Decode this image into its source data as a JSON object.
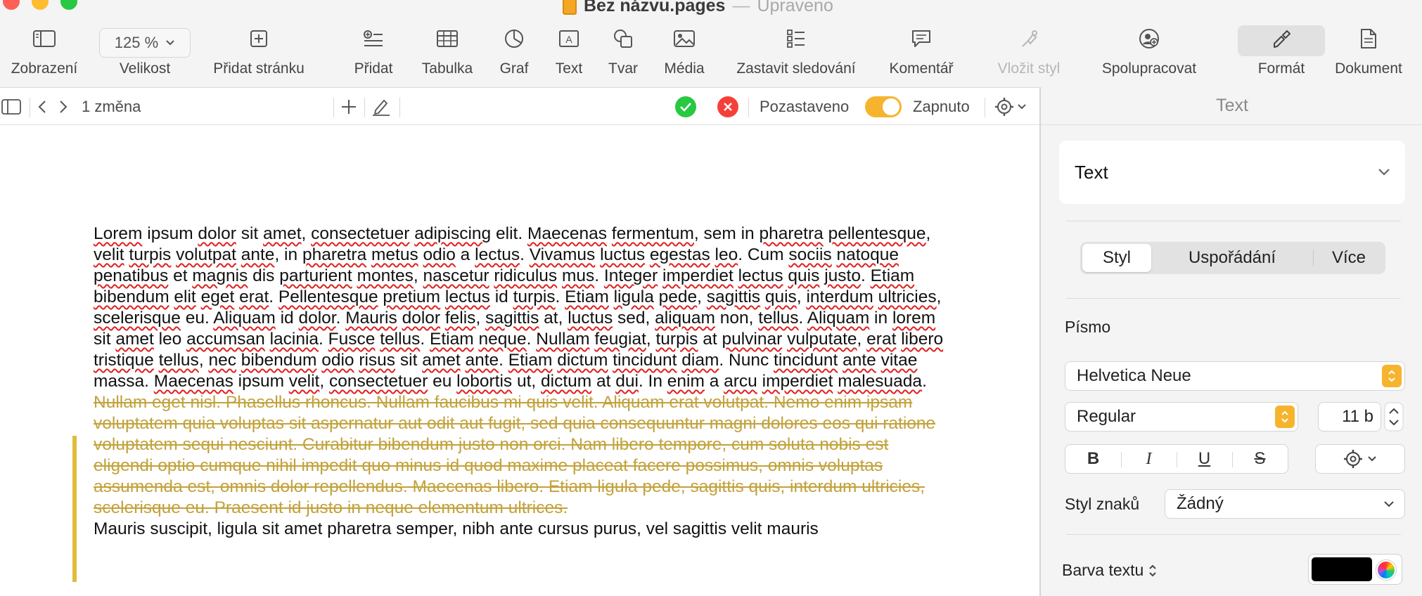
{
  "window": {
    "doc_name": "Bez názvu.pages",
    "separator": "—",
    "status": "Upraveno"
  },
  "toolbar": {
    "zoom_value": "125 %",
    "items": [
      {
        "label": "Zobrazení",
        "icon": "sidebar-icon"
      },
      {
        "label": "Velikost",
        "icon": "zoom-popup"
      },
      {
        "label": "Přidat stránku",
        "icon": "add-page-icon"
      },
      {
        "label": "Přidat",
        "icon": "insert-icon"
      },
      {
        "label": "Tabulka",
        "icon": "table-icon"
      },
      {
        "label": "Graf",
        "icon": "chart-icon"
      },
      {
        "label": "Text",
        "icon": "text-box-icon"
      },
      {
        "label": "Tvar",
        "icon": "shape-icon"
      },
      {
        "label": "Média",
        "icon": "media-icon"
      },
      {
        "label": "Zastavit sledování",
        "icon": "track-changes-icon"
      },
      {
        "label": "Komentář",
        "icon": "comment-icon"
      },
      {
        "label": "Vložit styl",
        "icon": "paste-style-icon"
      },
      {
        "label": "Spolupracovat",
        "icon": "collaborate-icon"
      },
      {
        "label": "Formát",
        "icon": "format-brush-icon"
      },
      {
        "label": "Dokument",
        "icon": "document-icon"
      }
    ]
  },
  "trackbar": {
    "changes": "1 změna",
    "paused_label": "Pozastaveno",
    "on_label": "Zapnuto"
  },
  "document": {
    "para1": [
      {
        "t": "Lorem",
        "s": 1
      },
      {
        "t": " ipsum "
      },
      {
        "t": "dolor",
        "s": 1
      },
      {
        "t": " sit "
      },
      {
        "t": "amet",
        "s": 1
      },
      {
        "t": ", "
      },
      {
        "t": "consectetuer",
        "s": 1
      },
      {
        "t": " "
      },
      {
        "t": "adipiscing",
        "s": 1
      },
      {
        "t": " elit. "
      },
      {
        "t": "Maecenas",
        "s": 1
      },
      {
        "t": " "
      },
      {
        "t": "fermentum",
        "s": 1
      },
      {
        "t": ", sem in "
      },
      {
        "t": "pharetra",
        "s": 1
      },
      {
        "t": " "
      },
      {
        "t": "pellentesque",
        "s": 1
      },
      {
        "t": ", "
      },
      {
        "t": "velit",
        "s": 1
      },
      {
        "t": " "
      },
      {
        "t": "turpis",
        "s": 1
      },
      {
        "t": " "
      },
      {
        "t": "volutpat",
        "s": 1
      },
      {
        "t": " "
      },
      {
        "t": "ante",
        "s": 1
      },
      {
        "t": ", in "
      },
      {
        "t": "pharetra",
        "s": 1
      },
      {
        "t": " "
      },
      {
        "t": "metus",
        "s": 1
      },
      {
        "t": " "
      },
      {
        "t": "odio",
        "s": 1
      },
      {
        "t": " a "
      },
      {
        "t": "lectus",
        "s": 1
      },
      {
        "t": ". "
      },
      {
        "t": "Vivamus",
        "s": 1
      },
      {
        "t": " "
      },
      {
        "t": "luctus",
        "s": 1
      },
      {
        "t": " "
      },
      {
        "t": "egestas",
        "s": 1
      },
      {
        "t": " "
      },
      {
        "t": "leo",
        "s": 1
      },
      {
        "t": ". Cum "
      },
      {
        "t": "sociis",
        "s": 1
      },
      {
        "t": " "
      },
      {
        "t": "natoque",
        "s": 1
      },
      {
        "t": " "
      },
      {
        "t": "penatibus",
        "s": 1
      },
      {
        "t": " et "
      },
      {
        "t": "magnis",
        "s": 1
      },
      {
        "t": " dis "
      },
      {
        "t": "parturient",
        "s": 1
      },
      {
        "t": " "
      },
      {
        "t": "montes",
        "s": 1
      },
      {
        "t": ", "
      },
      {
        "t": "nascetur",
        "s": 1
      },
      {
        "t": " "
      },
      {
        "t": "ridiculus",
        "s": 1
      },
      {
        "t": " "
      },
      {
        "t": "mus",
        "s": 1
      },
      {
        "t": ". "
      },
      {
        "t": "Integer",
        "s": 1
      },
      {
        "t": " "
      },
      {
        "t": "imperdiet",
        "s": 1
      },
      {
        "t": " "
      },
      {
        "t": "lectus",
        "s": 1
      },
      {
        "t": " "
      },
      {
        "t": "quis",
        "s": 1
      },
      {
        "t": " "
      },
      {
        "t": "justo",
        "s": 1
      },
      {
        "t": ". "
      },
      {
        "t": "Etiam",
        "s": 1
      },
      {
        "t": " "
      },
      {
        "t": "bibendum",
        "s": 1
      },
      {
        "t": " "
      },
      {
        "t": "elit",
        "s": 1
      },
      {
        "t": " "
      },
      {
        "t": "eget",
        "s": 1
      },
      {
        "t": " "
      },
      {
        "t": "erat",
        "s": 1
      },
      {
        "t": ". "
      },
      {
        "t": "Pellentesque",
        "s": 1
      },
      {
        "t": " "
      },
      {
        "t": "pretium",
        "s": 1
      },
      {
        "t": " "
      },
      {
        "t": "lectus",
        "s": 1
      },
      {
        "t": " id "
      },
      {
        "t": "turpis",
        "s": 1
      },
      {
        "t": ". "
      },
      {
        "t": "Etiam",
        "s": 1
      },
      {
        "t": " "
      },
      {
        "t": "ligula",
        "s": 1
      },
      {
        "t": " "
      },
      {
        "t": "pede",
        "s": 1
      },
      {
        "t": ", "
      },
      {
        "t": "sagittis",
        "s": 1
      },
      {
        "t": " "
      },
      {
        "t": "quis",
        "s": 1
      },
      {
        "t": ", "
      },
      {
        "t": "interdum",
        "s": 1
      },
      {
        "t": " "
      },
      {
        "t": "ultricies",
        "s": 1
      },
      {
        "t": ", "
      },
      {
        "t": "scelerisque",
        "s": 1
      },
      {
        "t": " eu. "
      },
      {
        "t": "Aliquam",
        "s": 1
      },
      {
        "t": " id "
      },
      {
        "t": "dolor",
        "s": 1
      },
      {
        "t": ". "
      },
      {
        "t": "Mauris",
        "s": 1
      },
      {
        "t": " "
      },
      {
        "t": "dolor",
        "s": 1
      },
      {
        "t": " "
      },
      {
        "t": "felis",
        "s": 1
      },
      {
        "t": ", "
      },
      {
        "t": "sagittis",
        "s": 1
      },
      {
        "t": " at, "
      },
      {
        "t": "luctus",
        "s": 1
      },
      {
        "t": " sed, "
      },
      {
        "t": "aliquam",
        "s": 1
      },
      {
        "t": " non, "
      },
      {
        "t": "tellus",
        "s": 1
      },
      {
        "t": ". "
      },
      {
        "t": "Aliquam",
        "s": 1
      },
      {
        "t": " in "
      },
      {
        "t": "lorem",
        "s": 1
      },
      {
        "t": " sit "
      },
      {
        "t": "amet",
        "s": 1
      },
      {
        "t": " leo "
      },
      {
        "t": "accumsan",
        "s": 1
      },
      {
        "t": " "
      },
      {
        "t": "lacinia",
        "s": 1
      },
      {
        "t": ". "
      },
      {
        "t": "Fusce",
        "s": 1
      },
      {
        "t": " "
      },
      {
        "t": "tellus",
        "s": 1
      },
      {
        "t": ". "
      },
      {
        "t": "Etiam",
        "s": 1
      },
      {
        "t": " "
      },
      {
        "t": "neque",
        "s": 1
      },
      {
        "t": ". "
      },
      {
        "t": "Nullam",
        "s": 1
      },
      {
        "t": " "
      },
      {
        "t": "feugiat",
        "s": 1
      },
      {
        "t": ", "
      },
      {
        "t": "turpis",
        "s": 1
      },
      {
        "t": " at "
      },
      {
        "t": "pulvinar",
        "s": 1
      },
      {
        "t": " "
      },
      {
        "t": "vulputate",
        "s": 1
      },
      {
        "t": ", "
      },
      {
        "t": "erat",
        "s": 1
      },
      {
        "t": " "
      },
      {
        "t": "libero",
        "s": 1
      },
      {
        "t": " "
      },
      {
        "t": "tristique",
        "s": 1
      },
      {
        "t": " "
      },
      {
        "t": "tellus",
        "s": 1
      },
      {
        "t": ", "
      },
      {
        "t": "nec",
        "s": 1
      },
      {
        "t": " "
      },
      {
        "t": "bibendum",
        "s": 1
      },
      {
        "t": " "
      },
      {
        "t": "odio",
        "s": 1
      },
      {
        "t": " "
      },
      {
        "t": "risus",
        "s": 1
      },
      {
        "t": " sit "
      },
      {
        "t": "amet",
        "s": 1
      },
      {
        "t": " "
      },
      {
        "t": "ante",
        "s": 1
      },
      {
        "t": ". "
      },
      {
        "t": "Etiam",
        "s": 1
      },
      {
        "t": " "
      },
      {
        "t": "dictum",
        "s": 1
      },
      {
        "t": " "
      },
      {
        "t": "tincidunt",
        "s": 1
      },
      {
        "t": " "
      },
      {
        "t": "diam",
        "s": 1
      },
      {
        "t": ". Nunc "
      },
      {
        "t": "tincidunt",
        "s": 1
      },
      {
        "t": " "
      },
      {
        "t": "ante",
        "s": 1
      },
      {
        "t": " "
      },
      {
        "t": "vitae",
        "s": 1
      },
      {
        "t": " massa. "
      },
      {
        "t": "Maecenas",
        "s": 1
      },
      {
        "t": " ipsum "
      },
      {
        "t": "velit",
        "s": 1
      },
      {
        "t": ", "
      },
      {
        "t": "consectetuer",
        "s": 1
      },
      {
        "t": " eu "
      },
      {
        "t": "lobortis",
        "s": 1
      },
      {
        "t": " ut, "
      },
      {
        "t": "dictum",
        "s": 1
      },
      {
        "t": " at "
      },
      {
        "t": "dui",
        "s": 1
      },
      {
        "t": ". In "
      },
      {
        "t": "enim",
        "s": 1
      },
      {
        "t": " a "
      },
      {
        "t": "arcu",
        "s": 1
      },
      {
        "t": " "
      },
      {
        "t": "imperdiet",
        "s": 1
      },
      {
        "t": " "
      },
      {
        "t": "malesuada",
        "s": 1
      },
      {
        "t": "."
      }
    ],
    "deleted": "Nullam eget nisl. Phasellus rhoncus. Nullam faucibus mi quis velit. Aliquam erat volutpat. Nemo enim ipsam voluptatem quia voluptas sit aspernatur aut odit aut fugit, sed quia consequuntur magni dolores eos qui ratione voluptatem sequi nesciunt. Curabitur bibendum justo non orci. Nam libero tempore, cum soluta nobis est eligendi optio cumque nihil impedit quo minus id quod maxime placeat facere possimus, omnis voluptas assumenda est, omnis dolor repellendus. Maecenas libero. Etiam ligula pede, sagittis quis, interdum ultricies, scelerisque eu. Praesent id justo in neque elementum ultrices.",
    "para3": "Mauris suscipit, ligula sit amet pharetra semper, nibh ante cursus purus, vel sagittis velit mauris"
  },
  "sidebar": {
    "header": "Text",
    "style_menu": "Text",
    "tabs": [
      "Styl",
      "Uspořádání",
      "Více"
    ],
    "font_section": "Písmo",
    "font_family": "Helvetica Neue",
    "font_weight": "Regular",
    "font_size": "11 b",
    "bold": "B",
    "italic": "I",
    "underline": "U",
    "strike": "S",
    "char_style_label": "Styl znaků",
    "char_style_value": "Žádný",
    "text_color_label": "Barva textu",
    "text_color": "#000000"
  },
  "colors": {
    "accent_orange": "#f6b42e",
    "accept_green": "#28c840",
    "reject_red": "#f5403a",
    "deleted_text": "#c2a23c"
  }
}
